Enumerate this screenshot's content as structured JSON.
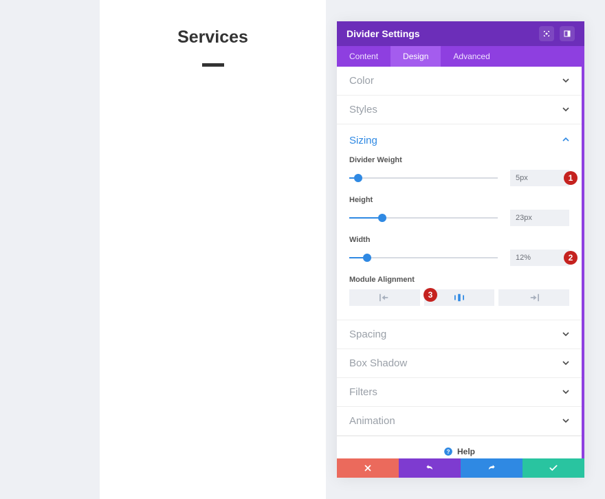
{
  "preview": {
    "title": "Services"
  },
  "panel": {
    "title": "Divider Settings",
    "tabs": [
      "Content",
      "Design",
      "Advanced"
    ],
    "active_tab": 1,
    "sections": {
      "color": "Color",
      "styles": "Styles",
      "sizing": "Sizing",
      "spacing": "Spacing",
      "boxshadow": "Box Shadow",
      "filters": "Filters",
      "animation": "Animation"
    },
    "sizing": {
      "weight": {
        "label": "Divider Weight",
        "value": "5px",
        "percent": 6
      },
      "height": {
        "label": "Height",
        "value": "23px",
        "percent": 22
      },
      "width": {
        "label": "Width",
        "value": "12%",
        "percent": 12
      },
      "alignment_label": "Module Alignment",
      "alignment": "center"
    },
    "help_label": "Help",
    "badges": {
      "b1": "1",
      "b2": "2",
      "b3": "3"
    }
  }
}
